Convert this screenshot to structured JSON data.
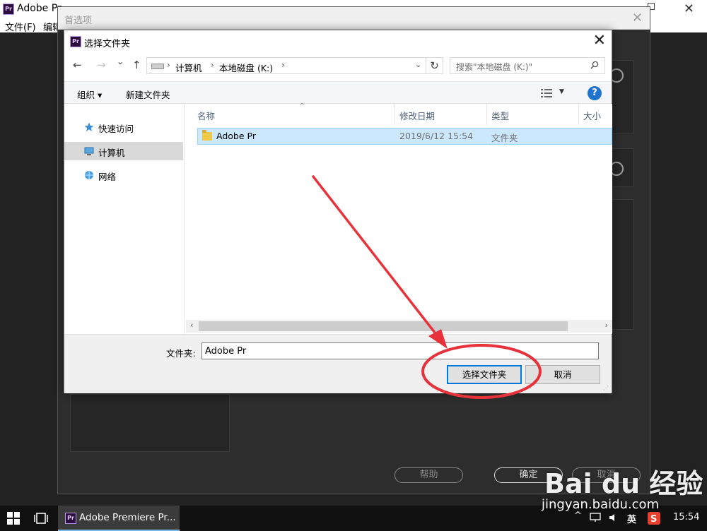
{
  "app": {
    "title": "Adobe Pr",
    "logo": "Pr",
    "close_glyph": "✕",
    "menu": [
      "文件(F)",
      "编辑"
    ]
  },
  "prefs": {
    "title": "首选项",
    "close_glyph": "✕",
    "buttons": {
      "help": "帮助",
      "ok": "确定",
      "cancel": "取消"
    }
  },
  "picker": {
    "title": "选择文件夹",
    "logo": "Pr",
    "close_glyph": "✕",
    "nav": {
      "back": "←",
      "forward": "→",
      "recent": "⌄",
      "up": "↑"
    },
    "breadcrumb": [
      "计算机",
      "本地磁盘 (K:)"
    ],
    "breadcrumb_sep": "›",
    "address_dropdown": "⌄",
    "refresh": "↻",
    "search_placeholder": "搜索\"本地磁盘 (K:)\"",
    "toolbar": {
      "organize": "组织 ▾",
      "new_folder": "新建文件夹",
      "help": "?"
    },
    "nav_items": [
      {
        "label": "快速访问",
        "icon": "star-icon"
      },
      {
        "label": "计算机",
        "icon": "computer-icon",
        "selected": true
      },
      {
        "label": "网络",
        "icon": "network-icon"
      }
    ],
    "columns": [
      "名称",
      "修改日期",
      "类型",
      "大小"
    ],
    "sort_glyph": "^",
    "files": [
      {
        "name": "Adobe Pr",
        "modified": "2019/6/12 15:54",
        "type": "文件夹"
      }
    ],
    "scroll_left": "‹",
    "scroll_right": "›",
    "folder_label": "文件夹:",
    "folder_value": "Adobe Pr",
    "select_button": "选择文件夹",
    "cancel_button": "取消",
    "resize_glyph": "⋰"
  },
  "taskbar": {
    "app_label": "Adobe Premiere Pr...",
    "ime": "英",
    "clock": "15:54",
    "tray_up": "^"
  },
  "watermark": {
    "brand": "Bai du 经验",
    "url": "jingyan.baidu.com"
  },
  "colors": {
    "accent": "#0078d7",
    "selection": "#cce8ff",
    "annotation": "#e8323b"
  }
}
